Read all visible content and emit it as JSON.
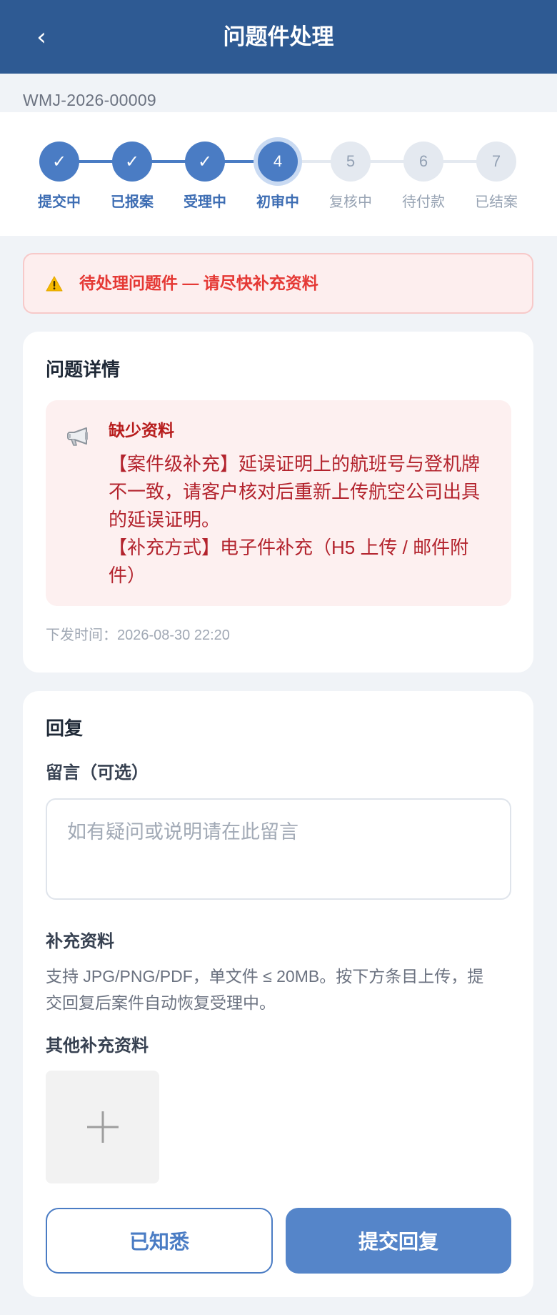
{
  "header": {
    "back_icon": "chevron-left-icon",
    "back_glyph": "‹",
    "title": "问题件处理"
  },
  "case_no": "WMJ-2026-00009",
  "stepper": {
    "current_step": 4,
    "steps": [
      {
        "label": "提交中",
        "mark": "✓",
        "status": "done"
      },
      {
        "label": "已报案",
        "mark": "✓",
        "status": "done"
      },
      {
        "label": "受理中",
        "mark": "✓",
        "status": "done"
      },
      {
        "label": "初审中",
        "mark": "4",
        "status": "current"
      },
      {
        "label": "复核中",
        "mark": "5",
        "status": "pending"
      },
      {
        "label": "待付款",
        "mark": "6",
        "status": "pending"
      },
      {
        "label": "已结案",
        "mark": "7",
        "status": "pending"
      }
    ]
  },
  "alert": {
    "icon": "warning-icon",
    "text": "待处理问题件 — 请尽快补充资料"
  },
  "detail_card": {
    "title": "问题详情",
    "notice": {
      "icon": "megaphone-icon",
      "title": "缺少资料",
      "paragraphs": [
        "【案件级补充】延误证明上的航班号与登机牌不一致，请客户核对后重新上传航空公司出具的延误证明。",
        "【补充方式】电子件补充（H5 上传 / 邮件附件）"
      ]
    },
    "issued_label": "下发时间：",
    "issued_time": "2026-08-30 22:20"
  },
  "reply_card": {
    "title": "回复",
    "message": {
      "label": "留言（可选）",
      "placeholder": "如有疑问或说明请在此留言"
    },
    "materials": {
      "title": "补充资料",
      "description": "支持 JPG/PNG/PDF，单文件 ≤ 20MB。按下方条目上传，提交回复后案件自动恢复受理中。",
      "items": [
        {
          "title": "其他补充资料",
          "upload_icon": "plus-icon"
        }
      ]
    }
  },
  "actions": {
    "acknowledge_label": "已知悉",
    "submit_label": "提交回复"
  },
  "colors": {
    "header_bg": "#2e5a93",
    "accent": "#4a7cc4",
    "page_bg": "#f0f3f7",
    "alert_bg": "#fdeeee",
    "alert_text": "#e53935",
    "notice_bg": "#fdf0f0",
    "notice_text": "#b3232d",
    "submit_bg": "#5585c9",
    "step_pending": "#e4e9f0"
  }
}
